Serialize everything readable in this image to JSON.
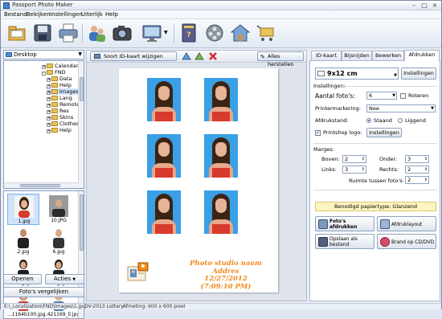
{
  "window": {
    "title": "Passport Photo Maker"
  },
  "menu": [
    "Bestand",
    "Bekijken",
    "Instellingen",
    "Uiterlijk",
    "Help"
  ],
  "toolbar": {
    "icons": [
      "open-folder-icon",
      "save-icon",
      "print-icon",
      "faces-icon",
      "camera-icon",
      "monitor-icon",
      "book-icon",
      "film-reel-icon",
      "home-icon",
      "cart-icon"
    ]
  },
  "left": {
    "location": "Desktop",
    "tree": [
      {
        "label": "Calendar 7.0"
      },
      {
        "label": "FND"
      },
      {
        "label": "Data"
      },
      {
        "label": "Help"
      },
      {
        "label": "Images"
      },
      {
        "label": "Lang"
      },
      {
        "label": "Remote"
      },
      {
        "label": "Res"
      },
      {
        "label": "Skins"
      },
      {
        "label": "Clothes"
      },
      {
        "label": "Help"
      }
    ],
    "thumbnails": [
      "1.jpg",
      "10.JPG",
      "2.jpg",
      "6.jpg",
      "8.jpg",
      "9.jpg",
      "...1164b100.jpg",
      "...421169_ll.jpg"
    ],
    "open_label": "Openen",
    "actions_label": "Acties",
    "compare_label": "Foto's vergelijken"
  },
  "center": {
    "change_type_label": "Soort ID-kaart wijzigen",
    "reset_all_label": "Alles herstellen",
    "studio_name": "Photo studio naam",
    "studio_address": "Addres",
    "studio_date": "12/27/2012",
    "studio_time": "(7:09:10 PM)"
  },
  "right": {
    "tabs": [
      "ID-kaart",
      "Bijsnijden",
      "Bewerken",
      "Afdrukken"
    ],
    "active_tab": "Afdrukken",
    "paper_size": "9x12 cm",
    "settings_button": "Instellingen",
    "settings_header": "Instellingen:",
    "photo_count_label": "Aantal foto's:",
    "photo_count": "6",
    "rotate_label": "Roteren",
    "printer_mark_label": "Printermarkering:",
    "printer_mark_value": "Nee",
    "print_pos_label": "Afdrukstand:",
    "portrait_label": "Staand",
    "landscape_label": "Liggend",
    "printshop_logo_label": "Printshop logo:",
    "printshop_settings_button": "Instellingen",
    "margins_header": "Marges:",
    "top_label": "Boven:",
    "top_value": "2",
    "bottom_label": "Onder:",
    "bottom_value": "3",
    "left_label": "Links:",
    "left_value": "3",
    "right_label": "Rechts:",
    "right_value": "2",
    "spacing_label": "Ruimte tussen foto's:",
    "spacing_value": "2",
    "paper_type_label": "Benodigd papiertype: Glanzend",
    "print_photos_label": "Foto's afdrukken",
    "print_layout_label": "Afdruklayout",
    "save_file_label": "Opslaan als bestand",
    "burn_cd_label": "Brand op CD/DVD"
  },
  "status": {
    "path": "E:\\_Localization\\FND\\Images\\1.jpg",
    "lottery": "DV-2013 Lottery",
    "size": "Afmeting: 600 x 600 pixel"
  }
}
